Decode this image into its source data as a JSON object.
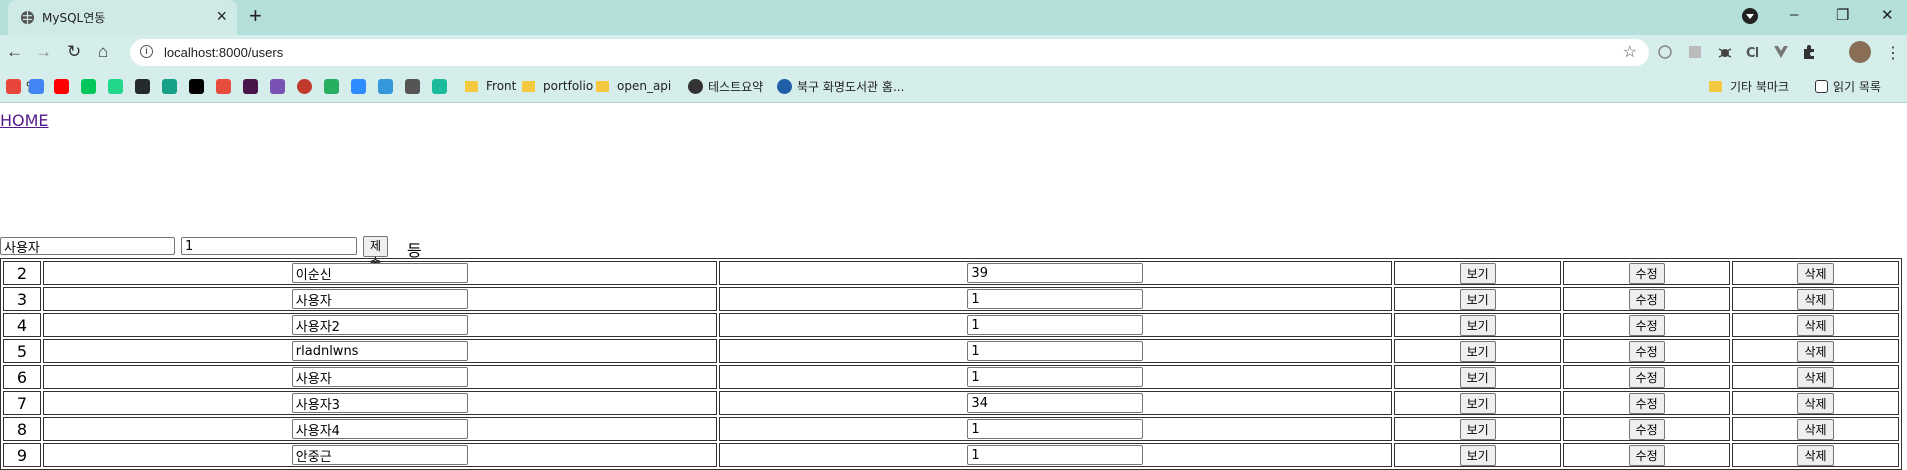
{
  "browser": {
    "tab_title": "MySQL연동",
    "url": "localhost:8000/users",
    "bookmarks": [
      {
        "label": "앱",
        "icon": "apps-grid-icon",
        "color": "#e8453c"
      },
      {
        "label": "",
        "icon": "google-icon",
        "color": "#4285f4"
      },
      {
        "label": "",
        "icon": "youtube-icon",
        "color": "#ff0000"
      },
      {
        "label": "",
        "icon": "naver-icon",
        "color": "#03c75a"
      },
      {
        "label": "",
        "icon": "px-icon",
        "color": "#21d789"
      },
      {
        "label": "",
        "icon": "github-icon",
        "color": "#24292e"
      },
      {
        "label": "",
        "icon": "diamond-icon",
        "color": "#16a085"
      },
      {
        "label": "",
        "icon": "triangle-icon",
        "color": "#000000"
      },
      {
        "label": "",
        "icon": "s-icon",
        "color": "#e74c3c"
      },
      {
        "label": "",
        "icon": "slack-icon",
        "color": "#4a154b"
      },
      {
        "label": "",
        "icon": "bootstrap-icon",
        "color": "#7952b3"
      },
      {
        "label": "",
        "icon": "ball-icon",
        "color": "#c0392b"
      },
      {
        "label": "",
        "icon": "circle-arrow-icon",
        "color": "#27ae60"
      },
      {
        "label": "",
        "icon": "zoom-icon",
        "color": "#2d8cff"
      },
      {
        "label": "",
        "icon": "c-icon",
        "color": "#3498db"
      },
      {
        "label": "",
        "icon": "pen-icon",
        "color": "#555555"
      },
      {
        "label": "",
        "icon": "m-icon",
        "color": "#1abc9c"
      },
      {
        "label": "Front",
        "icon": "folder-icon",
        "color": "#f5c842"
      },
      {
        "label": "portfolio",
        "icon": "folder-icon",
        "color": "#f5c842"
      },
      {
        "label": "open_api",
        "icon": "folder-icon",
        "color": "#f5c842"
      },
      {
        "label": "테스트요약",
        "icon": "globe-icon",
        "color": "#333333"
      },
      {
        "label": "북구 화명도서관 홈...",
        "icon": "library-icon",
        "color": "#1e5fa8"
      }
    ],
    "other_bookmarks": "기타 북마크",
    "reading_list": "읽기 목록"
  },
  "page": {
    "home_link": "HOME",
    "form": {
      "name_value": "사용자",
      "age_value": "1",
      "submit_label": "제출",
      "register_text": "등록"
    },
    "buttons": {
      "view": "보기",
      "edit": "수정",
      "delete": "삭제"
    },
    "users": [
      {
        "id": "2",
        "name": "이순신",
        "age": "39"
      },
      {
        "id": "3",
        "name": "사용자",
        "age": "1"
      },
      {
        "id": "4",
        "name": "사용자2",
        "age": "1"
      },
      {
        "id": "5",
        "name": "rladnlwns",
        "age": "1"
      },
      {
        "id": "6",
        "name": "사용자",
        "age": "1"
      },
      {
        "id": "7",
        "name": "사용자3",
        "age": "34"
      },
      {
        "id": "8",
        "name": "사용자4",
        "age": "1"
      },
      {
        "id": "9",
        "name": "안중근",
        "age": "1"
      }
    ]
  }
}
